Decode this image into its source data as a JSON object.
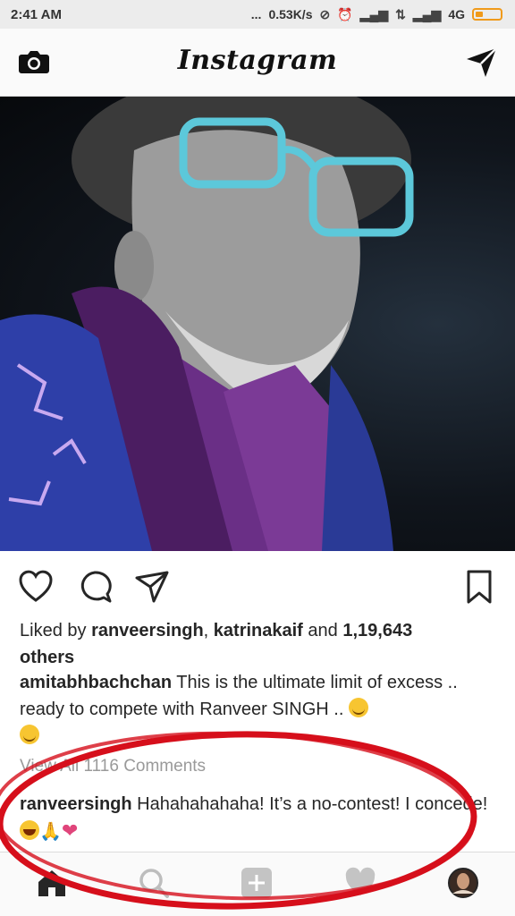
{
  "status_bar": {
    "time": "2:41 AM",
    "dots": "...",
    "speed": "0.53K/s",
    "network": "4G"
  },
  "header": {
    "logo": "Instagram",
    "left_icon": "camera-icon",
    "right_icon": "direct-message-icon"
  },
  "post": {
    "image_alt": "photo",
    "actions": [
      "heart-icon",
      "comment-icon",
      "share-icon",
      "bookmark-icon"
    ],
    "likes_prefix": "Liked by ",
    "liker1": "ranveersingh",
    "likes_sep": ", ",
    "liker2": "katrinakaif",
    "likes_and": " and ",
    "likes_count": "1,19,643",
    "likes_others": "others",
    "caption_user": "amitabhbachchan",
    "caption_text": " This is the ultimate limit of excess .. ready to compete with Ranveer SINGH .. ",
    "view_all": "View All 1116 Comments",
    "comment_user": "ranveersingh",
    "comment_text": " Hahahahahaha! It’s a no-contest! I concede! "
  },
  "bottom_nav": [
    "home-icon",
    "search-icon",
    "add-post-icon",
    "activity-heart-icon",
    "profile-avatar"
  ],
  "colors": {
    "annotation": "#d60f1b",
    "accent_battery": "#f09a1a",
    "heart_emoji": "#e0457b"
  }
}
